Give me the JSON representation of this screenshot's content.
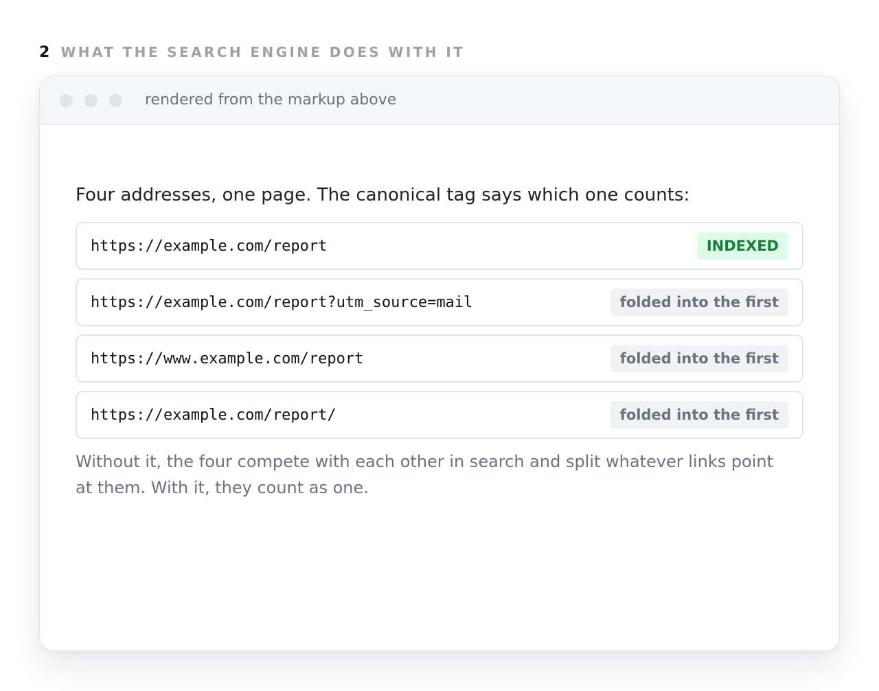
{
  "section": {
    "number": "2",
    "title": "WHAT THE SEARCH ENGINE DOES WITH IT"
  },
  "window": {
    "caption": "rendered from the markup above"
  },
  "content": {
    "intro": "Four addresses, one page. The canonical tag says which one counts:",
    "urls": [
      {
        "url": "https://example.com/report",
        "status": "INDEXED",
        "status_color": "#15803d"
      },
      {
        "url": "https://example.com/report?utm_source=mail",
        "status": "folded into the first",
        "status_color": "#6b7280"
      },
      {
        "url": "https://www.example.com/report",
        "status": "folded into the first",
        "status_color": "#6b7280"
      },
      {
        "url": "https://example.com/report/",
        "status": "folded into the first",
        "status_color": "#6b7280"
      }
    ],
    "footnote": "Without it, the four compete with each other in search and split whatever links point at them. With it, they count as one."
  },
  "colors": {
    "indexed_bg": "#dcfce7",
    "indexed_text": "#15803d",
    "folded_bg": "#f1f2f4",
    "folded_text": "#6b7280"
  }
}
